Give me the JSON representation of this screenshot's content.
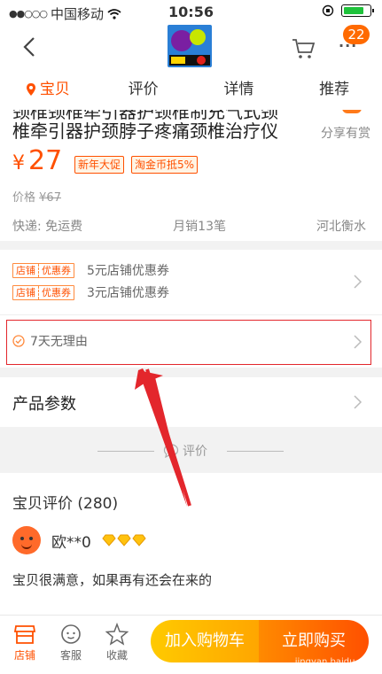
{
  "status_bar": {
    "carrier": "中国移动",
    "time": "10:56"
  },
  "nav": {
    "cart_badge": "22",
    "more": "···"
  },
  "tabs": [
    {
      "label": "宝贝",
      "active": true
    },
    {
      "label": "评价",
      "active": false
    },
    {
      "label": "详情",
      "active": false
    },
    {
      "label": "推荐",
      "active": false
    }
  ],
  "product": {
    "title_partial": "颈椎颈椎牵引器护颈椎制充气式颈",
    "title_line2": "椎牵引器护颈脖子疼痛颈椎治疗仪",
    "share": "分享有赏",
    "currency": "¥",
    "price": "27",
    "tag1": "新年大促",
    "tag2": "淘金币抵5%",
    "orig_label": "价格",
    "orig_price": "¥67",
    "shipping": "快递: 免运费",
    "monthly_sales": "月销13笔",
    "location": "河北衡水"
  },
  "coupons": [
    {
      "tag_a": "店铺",
      "tag_b": "优惠券",
      "text": "5元店铺优惠券"
    },
    {
      "tag_a": "店铺",
      "tag_b": "优惠券",
      "text": "3元店铺优惠券"
    }
  ],
  "guarantee": {
    "text": "7天无理由"
  },
  "params": {
    "label": "产品参数"
  },
  "divider": {
    "label": "评价"
  },
  "reviews": {
    "header": "宝贝评价 (280)",
    "nickname": "欧**0",
    "comment": "宝贝很满意，如果再有还会在来的"
  },
  "bottom_bar": {
    "shop": "店铺",
    "service": "客服",
    "favorite": "收藏",
    "add_to_cart": "加入购物车",
    "buy_now": "立即购买",
    "watermark": "jingyan.baidu.com"
  },
  "colors": {
    "accent": "#ff5000",
    "highlight_box": "#e3262c"
  }
}
